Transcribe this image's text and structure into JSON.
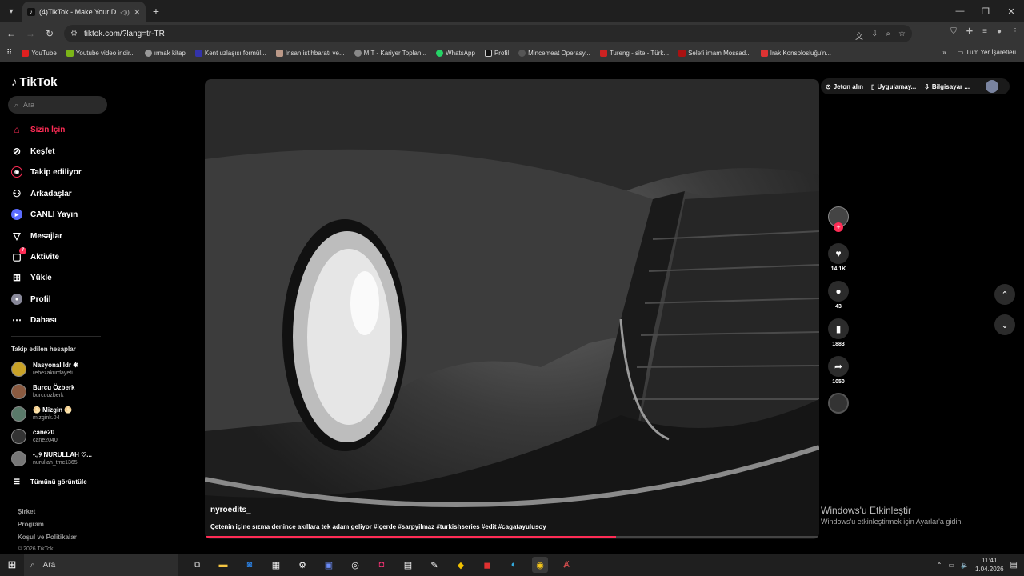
{
  "browser": {
    "tab_title": "(4)TikTok - Make Your Day",
    "url": "tiktok.com/?lang=tr-TR",
    "bookmarks": [
      "YouTube",
      "Youtube video indir...",
      "ırmak kitap",
      "Kent uzlaşısı formül...",
      "İnsan istihbaratı ve...",
      "MİT - Kariyer Toplan...",
      "WhatsApp",
      "Profil",
      "Mincemeat Operasy...",
      "Tureng - site - Türk...",
      "Selefi imam Mossad...",
      "Irak Konsolosluğu'n..."
    ],
    "all_bookmarks_label": "Tüm Yer İşaretleri"
  },
  "sidebar": {
    "logo": "TikTok",
    "search_placeholder": "Ara",
    "menu": [
      {
        "label": "Sizin İçin",
        "icon": "home-icon"
      },
      {
        "label": "Keşfet",
        "icon": "compass-icon"
      },
      {
        "label": "Takip ediliyor",
        "icon": "following-icon"
      },
      {
        "label": "Arkadaşlar",
        "icon": "friends-icon"
      },
      {
        "label": "CANLI Yayın",
        "icon": "live-icon"
      },
      {
        "label": "Mesajlar",
        "icon": "messages-icon"
      },
      {
        "label": "Aktivite",
        "icon": "activity-icon",
        "badge": "7"
      },
      {
        "label": "Yükle",
        "icon": "upload-icon"
      },
      {
        "label": "Profil",
        "icon": "profile-icon"
      },
      {
        "label": "Dahası",
        "icon": "more-icon"
      }
    ],
    "following_header": "Takip edilen hesaplar",
    "accounts": [
      {
        "name": "Nasyonal İdr ❋",
        "user": "rebezakurdayeti"
      },
      {
        "name": "Burcu Özberk",
        "user": "burcuozberk"
      },
      {
        "name": "🌕 Mizgin 🌕",
        "user": "mizgink.04"
      },
      {
        "name": "cane20",
        "user": "cane2040"
      },
      {
        "name": "•.̥.୨ NURULLAH ♡...",
        "user": "nurullah_tmc1365"
      }
    ],
    "see_all": "Tümünü görüntüle",
    "footer": [
      "Şirket",
      "Program",
      "Koşul ve Politikalar",
      "© 2026 TikTok"
    ]
  },
  "top_right": {
    "coins": "Jeton alın",
    "app": "Uygulamay...",
    "desktop": "Bilgisayar ..."
  },
  "video": {
    "username": "nyroedits_",
    "caption": "Çetenin içine sızma denince akıllara tek adam geliyor #içerde #sarpyilmaz #turkishseries #edit #cagatayulusoy",
    "progress": 0.67,
    "likes": "14.1K",
    "comments": "43",
    "saves": "1883",
    "shares": "1050"
  },
  "overlay": {
    "activate_title": "Windows'u Etkinleştir",
    "activate_sub": "Windows'u etkinleştirmek için Ayarlar'a gidin."
  },
  "taskbar": {
    "search": "Ara",
    "time": "11:41",
    "date": "1.04.2026"
  }
}
